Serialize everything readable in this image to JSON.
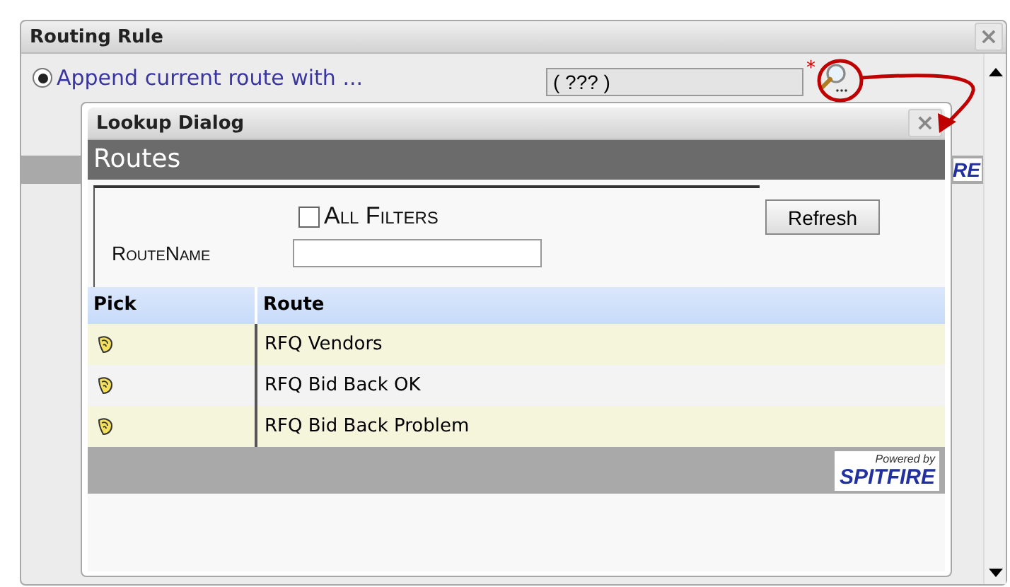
{
  "routing_rule": {
    "title": "Routing Rule",
    "close": "×",
    "option": {
      "label": "Append current route with ...",
      "selected": true
    },
    "value": "( ??? )",
    "required_mark": "*",
    "background_logo": "RE"
  },
  "lookup_dialog": {
    "title": "Lookup Dialog",
    "close": "×",
    "section": "Routes",
    "filters": {
      "all_filters": {
        "label": "All Filters",
        "checked": false
      },
      "refresh": "Refresh",
      "field": {
        "label": "RouteName"
      }
    },
    "table": {
      "columns": [
        "Pick",
        "Route"
      ],
      "rows": [
        {
          "route": "RFQ Vendors"
        },
        {
          "route": "RFQ Bid Back OK"
        },
        {
          "route": "RFQ Bid Back Problem"
        }
      ]
    },
    "footer_logo": {
      "caption": "Powered by",
      "name": "SPITFIRE"
    }
  }
}
